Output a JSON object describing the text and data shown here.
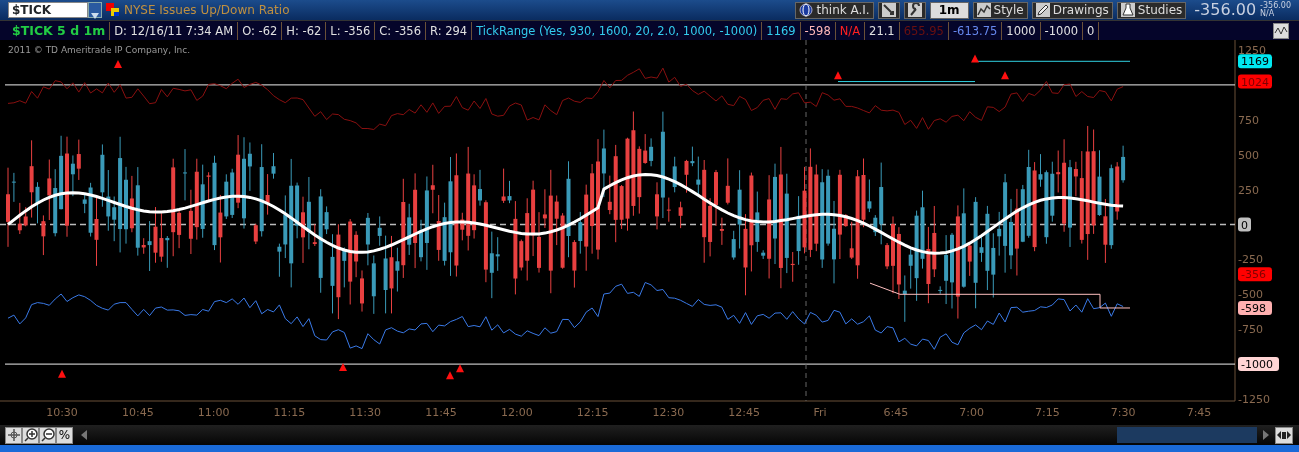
{
  "toolbar": {
    "symbol": "$TICK",
    "description": "NYSE Issues Up/Down Ratio",
    "buttons": [
      {
        "kind": "globe",
        "label": "think A.I."
      },
      {
        "kind": "tool"
      },
      {
        "kind": "wrench"
      },
      {
        "kind": "text",
        "label": "1m"
      },
      {
        "kind": "style",
        "label": "Style"
      },
      {
        "kind": "pencil",
        "label": "Drawings"
      },
      {
        "kind": "flask",
        "label": "Studies"
      }
    ],
    "last_price": "-356.00",
    "mini_price": "-356.00",
    "mini_status": "N/A"
  },
  "legend": [
    {
      "text": "$TICK 5 d 1m",
      "color": "#22cc44"
    },
    {
      "text": "D: 12/16/11 7:34 AM",
      "color": "#e0e0e0"
    },
    {
      "text": "O: -62",
      "color": "#e0e0e0"
    },
    {
      "text": "H: -62",
      "color": "#e0e0e0"
    },
    {
      "text": "L: -356",
      "color": "#e0e0e0"
    },
    {
      "text": "C: -356",
      "color": "#e0e0e0"
    },
    {
      "text": "R: 294",
      "color": "#e0e0e0"
    },
    {
      "text": "TickRange (Yes, 930, 1600, 20, 2.0, 1000, -1000)",
      "color": "#33ccee"
    },
    {
      "text": "1169",
      "color": "#33ccee"
    },
    {
      "text": "-598",
      "color": "#ffb8b8"
    },
    {
      "text": "N/A",
      "color": "#ff2020"
    },
    {
      "text": "21.1",
      "color": "#e0e0e0"
    },
    {
      "text": "655.95",
      "color": "#6a1010"
    },
    {
      "text": "-613.75",
      "color": "#6688ee"
    },
    {
      "text": "1000",
      "color": "#e0e0e0"
    },
    {
      "text": "-1000",
      "color": "#e0e0e0"
    },
    {
      "text": "0",
      "color": "#e0e0e0"
    }
  ],
  "chart": {
    "copyright": "2011 © TD Ameritrade IP Company, Inc.",
    "y_labels": [
      "1250",
      "750",
      "500",
      "250",
      "-250",
      "-500",
      "-750",
      "-1250"
    ],
    "badges": [
      {
        "text": "1169",
        "color": "#00e8f0"
      },
      {
        "text": "1024",
        "color": "#ff0000"
      },
      {
        "text": "0",
        "color": "#c0c0c0"
      },
      {
        "text": "-356",
        "color": "#ff0000"
      },
      {
        "text": "-598",
        "color": "#ffb0b0"
      },
      {
        "text": "-1000",
        "color": "#ffd4d4"
      }
    ],
    "x_labels": [
      "10:30",
      "10:45",
      "11:00",
      "11:15",
      "11:30",
      "11:45",
      "12:00",
      "12:15",
      "12:30",
      "12:45",
      "Fri",
      "6:45",
      "7:00",
      "7:15",
      "7:30",
      "7:45"
    ]
  },
  "controls": [
    {
      "kind": "crosshair"
    },
    {
      "kind": "zoom-in"
    },
    {
      "kind": "zoom-out"
    },
    {
      "kind": "text",
      "label": "%"
    }
  ]
}
